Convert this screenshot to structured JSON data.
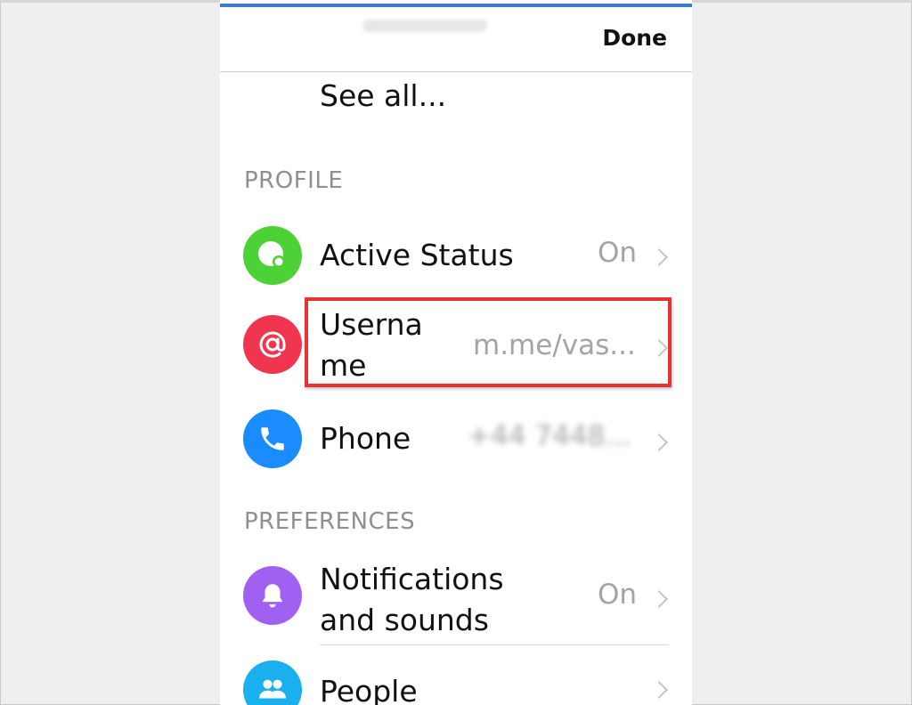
{
  "nav": {
    "done_label": "Done"
  },
  "see_all_label": "See all...",
  "sections": {
    "profile_header": "PROFILE",
    "preferences_header": "PREFERENCES"
  },
  "rows": {
    "active_status": {
      "label": "Active Status",
      "value": "On",
      "icon": "active-status-icon",
      "color": "#4cd137"
    },
    "username": {
      "label_line1": "Userna",
      "label_line2": "me",
      "value": "m.me/vas...",
      "icon": "at-sign-icon",
      "color": "#f0354f"
    },
    "phone": {
      "label": "Phone",
      "value": "+44 7448...",
      "icon": "phone-icon",
      "color": "#1a8cff"
    },
    "notifications": {
      "label_line1": "Notifications",
      "label_line2": "and sounds",
      "value": "On",
      "icon": "bell-icon",
      "color": "#a061f2"
    },
    "people": {
      "label": "People",
      "icon": "people-icon",
      "color": "#1ab0f0"
    }
  },
  "highlight_color": "#e83333"
}
